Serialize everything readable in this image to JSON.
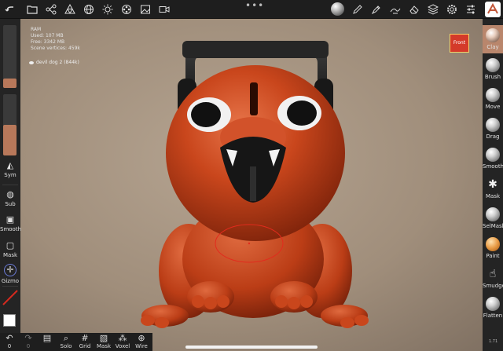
{
  "colors": {
    "accent": "#b9866c",
    "model": "#cc4a1f",
    "front_button": "#d43a2a",
    "bar": "#1e1e1e"
  },
  "topbar": {
    "left_icons": [
      "folder-icon",
      "scene-graph-icon",
      "mesh-icon",
      "globe-icon",
      "sun-icon",
      "film-reel-icon",
      "image-icon",
      "video-icon"
    ],
    "right_icons": [
      "material-ball-icon",
      "pen-icon",
      "pencil-icon",
      "brush-stroke-icon",
      "layers-icon",
      "gear-icon",
      "sliders-icon",
      "nomad-logo-icon"
    ]
  },
  "info": {
    "line1": "RAM",
    "line2": "Used: 107 MB",
    "line3": "Free: 3342 MB",
    "line4": "Scene vertices: 459k"
  },
  "scene": {
    "object_name": "devil dog 2 (844k)"
  },
  "view": {
    "front_label": "Front",
    "zoom": "1.71"
  },
  "left_panel": {
    "radius_level": 0.1,
    "intensity_level": 0.5,
    "sym_label": "Sym",
    "sub_label": "Sub",
    "smooth_label": "Smooth",
    "mask_label": "Mask",
    "gizmo_label": "Gizmo"
  },
  "tools": [
    {
      "label": "Clay",
      "active": true
    },
    {
      "label": "Brush",
      "active": false
    },
    {
      "label": "Move",
      "active": false
    },
    {
      "label": "Drag",
      "active": false
    },
    {
      "label": "Smooth",
      "active": false
    },
    {
      "label": "Mask",
      "active": false
    },
    {
      "label": "SelMask",
      "active": false
    },
    {
      "label": "Paint",
      "active": false
    },
    {
      "label": "Smudge",
      "active": false
    },
    {
      "label": "Flatten",
      "active": false
    }
  ],
  "bottom": {
    "undo_count": "0",
    "redo_count": "0",
    "solo": "Solo",
    "grid": "Grid",
    "mask": "Mask",
    "voxel": "Voxel",
    "wire": "Wire"
  }
}
